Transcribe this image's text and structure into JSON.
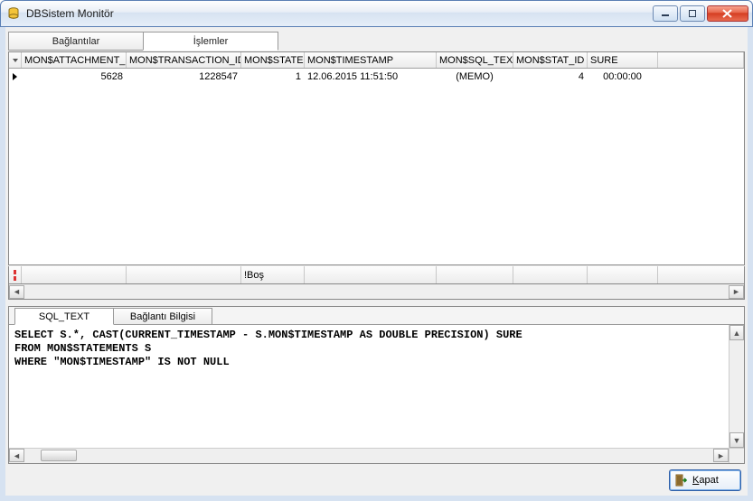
{
  "window": {
    "title": "DBSistem Monitör"
  },
  "top_tabs": {
    "connections": "Bağlantılar",
    "transactions": "İşlemler"
  },
  "grid": {
    "headers": {
      "attachment_id": "MON$ATTACHMENT_ID",
      "transaction_id": "MON$TRANSACTION_ID",
      "state": "MON$STATE",
      "timestamp": "MON$TIMESTAMP",
      "sql_tex": "MON$SQL_TEX",
      "stat_id": "MON$STAT_ID",
      "sure": "SURE"
    },
    "rows": [
      {
        "attachment_id": "5628",
        "transaction_id": "1228547",
        "state": "1",
        "timestamp": "12.06.2015 11:51:50",
        "sql_tex": "(MEMO)",
        "stat_id": "4",
        "sure": "00:00:00"
      }
    ],
    "footer_minstate": "!Boş"
  },
  "sub_tabs": {
    "sql_text": "SQL_TEXT",
    "conn_info": "Bağlantı Bilgisi"
  },
  "sql_body": "SELECT S.*, CAST(CURRENT_TIMESTAMP - S.MON$TIMESTAMP AS DOUBLE PRECISION) SURE\nFROM MON$STATEMENTS S\nWHERE \"MON$TIMESTAMP\" IS NOT NULL",
  "buttons": {
    "close": "Kapat"
  }
}
